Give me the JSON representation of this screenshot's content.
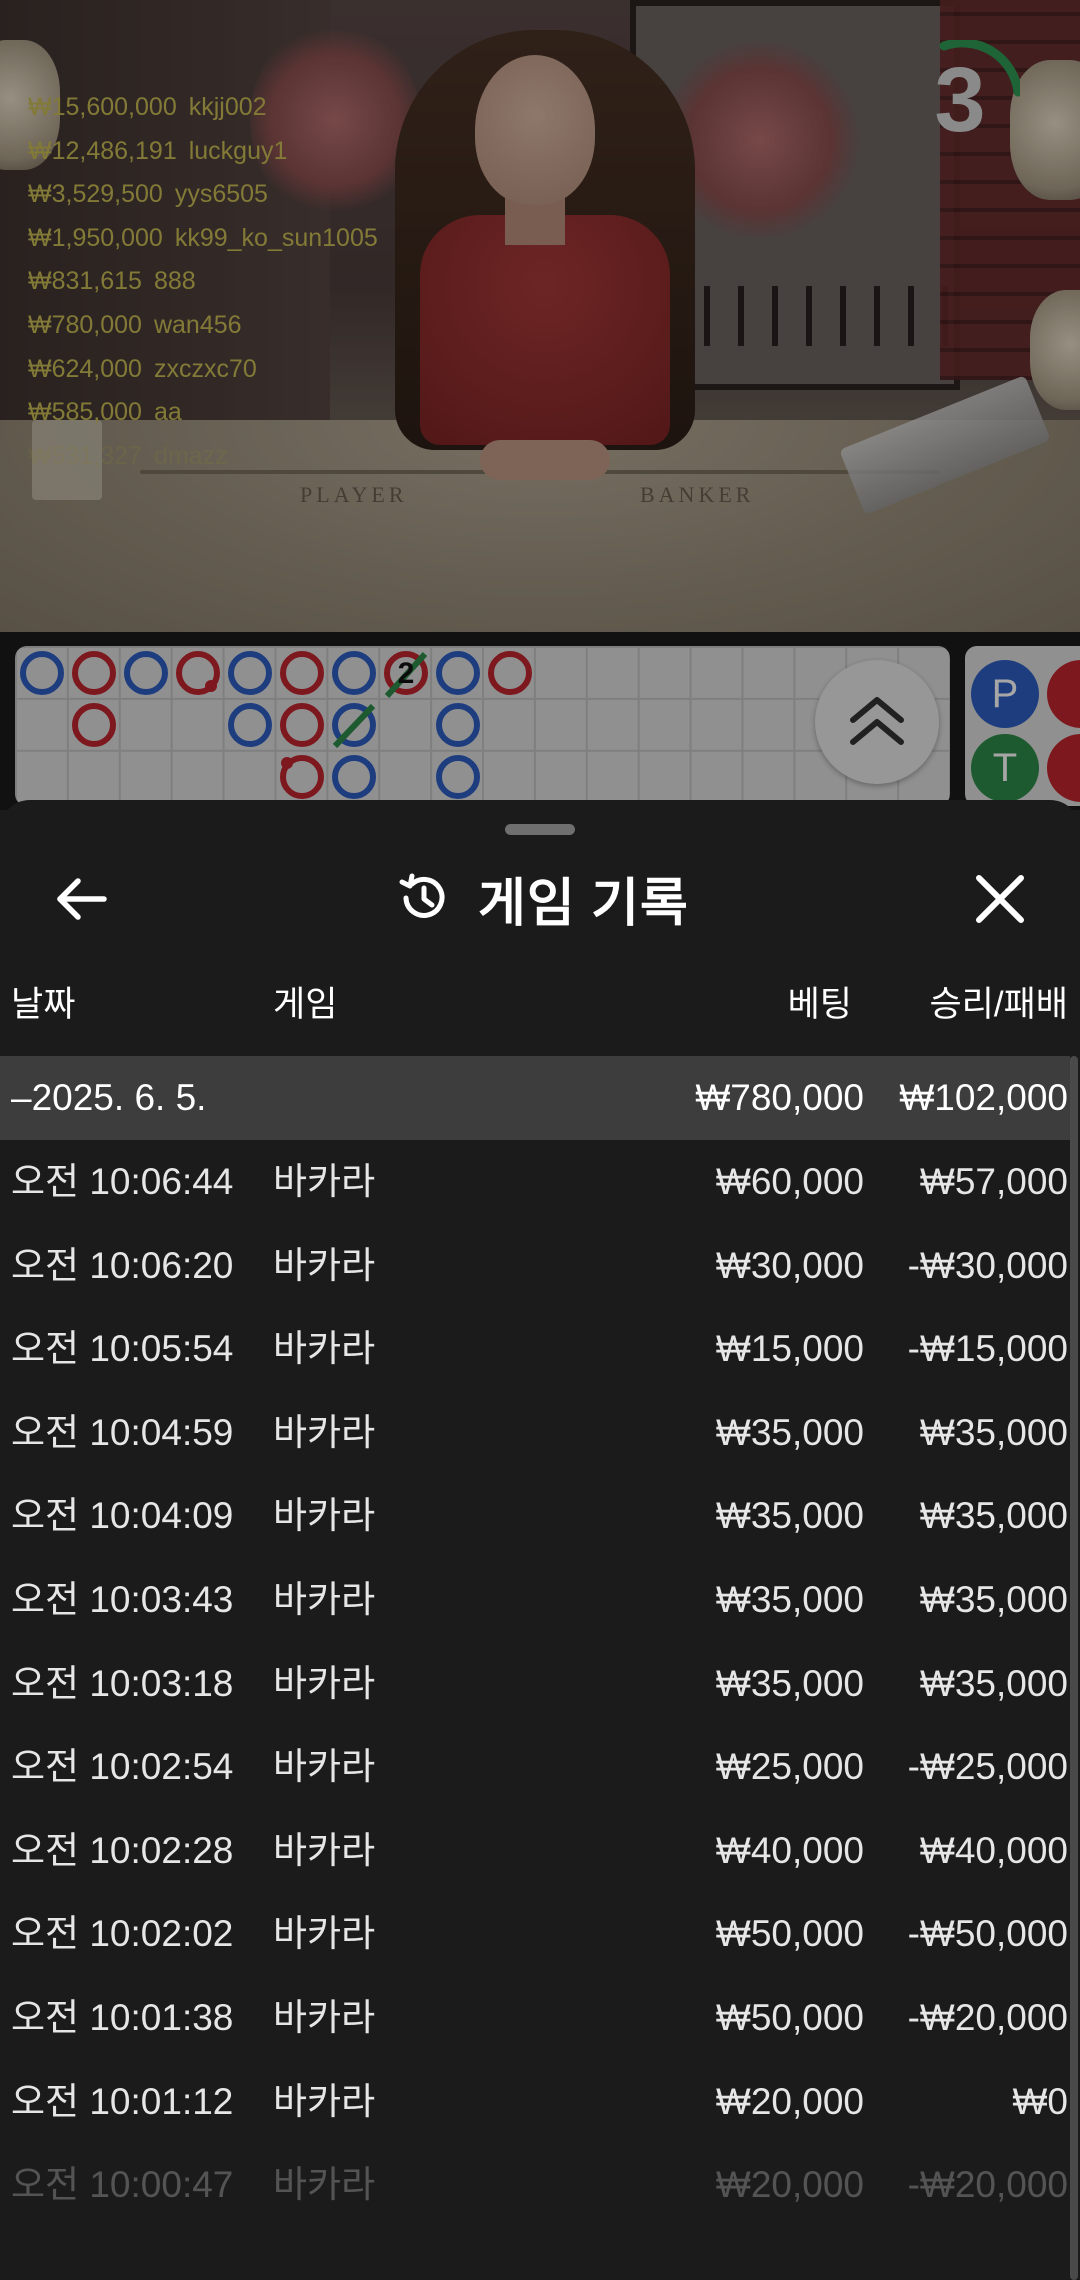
{
  "leaderboard": [
    {
      "amount": "₩15,600,000",
      "user": "kkjj002"
    },
    {
      "amount": "₩12,486,191",
      "user": "luckguy1"
    },
    {
      "amount": "₩3,529,500",
      "user": "yys6505"
    },
    {
      "amount": "₩1,950,000",
      "user": "kk99_ko_sun1005"
    },
    {
      "amount": "₩831,615",
      "user": "888"
    },
    {
      "amount": "₩780,000",
      "user": "wan456"
    },
    {
      "amount": "₩624,000",
      "user": "zxczxc70"
    },
    {
      "amount": "₩585,000",
      "user": "aa"
    },
    {
      "amount": "₩531,327",
      "user": "dmazz"
    }
  ],
  "table": {
    "player_label": "PLAYER",
    "banker_label": "BANKER"
  },
  "countdown": "3",
  "roadmap": {
    "tie_count": "2",
    "badges": {
      "player": "P",
      "tie": "T"
    }
  },
  "sheet": {
    "title": "게임 기록",
    "icons": {
      "back": "arrow-left-icon",
      "history": "history-icon",
      "close": "close-icon"
    },
    "columns": {
      "date": "날짜",
      "game": "게임",
      "bet": "베팅",
      "result": "승리/패배"
    },
    "summary": {
      "date": "–2025. 6. 5.",
      "bet": "₩780,000",
      "result": "₩102,000"
    },
    "rows": [
      {
        "time": "오전 10:06:44",
        "game": "바카라",
        "bet": "₩60,000",
        "result": "₩57,000"
      },
      {
        "time": "오전 10:06:20",
        "game": "바카라",
        "bet": "₩30,000",
        "result": "-₩30,000"
      },
      {
        "time": "오전 10:05:54",
        "game": "바카라",
        "bet": "₩15,000",
        "result": "-₩15,000"
      },
      {
        "time": "오전 10:04:59",
        "game": "바카라",
        "bet": "₩35,000",
        "result": "₩35,000"
      },
      {
        "time": "오전 10:04:09",
        "game": "바카라",
        "bet": "₩35,000",
        "result": "₩35,000"
      },
      {
        "time": "오전 10:03:43",
        "game": "바카라",
        "bet": "₩35,000",
        "result": "₩35,000"
      },
      {
        "time": "오전 10:03:18",
        "game": "바카라",
        "bet": "₩35,000",
        "result": "₩35,000"
      },
      {
        "time": "오전 10:02:54",
        "game": "바카라",
        "bet": "₩25,000",
        "result": "-₩25,000"
      },
      {
        "time": "오전 10:02:28",
        "game": "바카라",
        "bet": "₩40,000",
        "result": "₩40,000"
      },
      {
        "time": "오전 10:02:02",
        "game": "바카라",
        "bet": "₩50,000",
        "result": "-₩50,000"
      },
      {
        "time": "오전 10:01:38",
        "game": "바카라",
        "bet": "₩50,000",
        "result": "-₩20,000"
      },
      {
        "time": "오전 10:01:12",
        "game": "바카라",
        "bet": "₩20,000",
        "result": "₩0"
      },
      {
        "time": "오전 10:00:47",
        "game": "바카라",
        "bet": "₩20,000",
        "result": "-₩20,000"
      }
    ]
  },
  "colors": {
    "player": "#2f5fc4",
    "banker": "#c0262e",
    "tie": "#2d8a4a",
    "leaderboard_text": "#c8bc54"
  }
}
